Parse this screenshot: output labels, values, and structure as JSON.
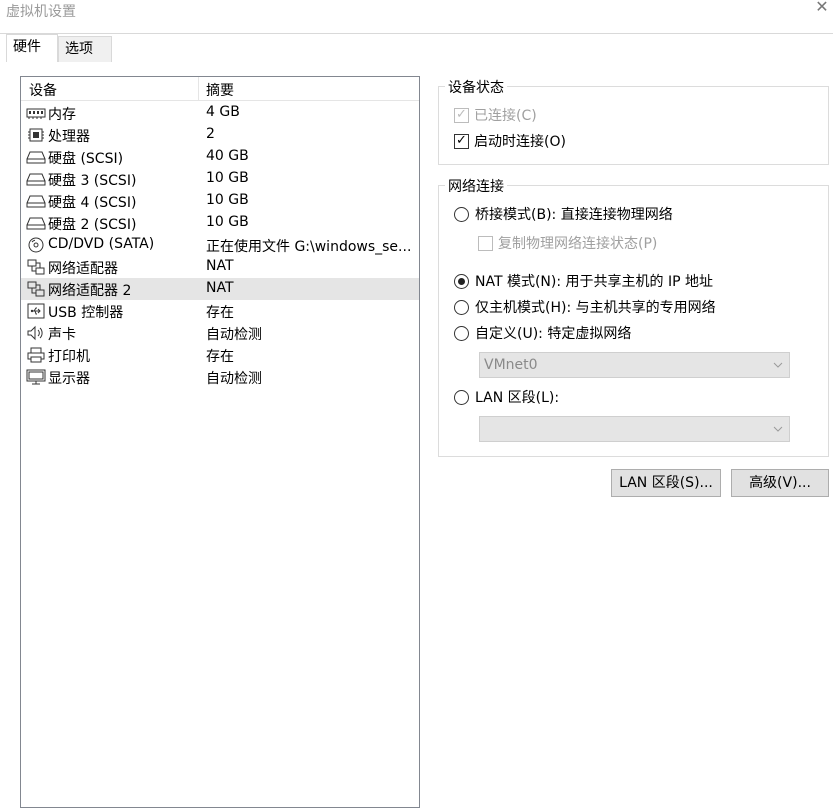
{
  "window": {
    "title": "虚拟机设置"
  },
  "tabs": [
    {
      "label": "硬件",
      "active": true
    },
    {
      "label": "选项",
      "active": false
    }
  ],
  "device_list": {
    "headers": {
      "device": "设备",
      "summary": "摘要"
    },
    "items": [
      {
        "icon": "memory-icon",
        "name": "内存",
        "summary": "4 GB"
      },
      {
        "icon": "cpu-icon",
        "name": "处理器",
        "summary": "2"
      },
      {
        "icon": "disk-icon",
        "name": "硬盘 (SCSI)",
        "summary": "40 GB"
      },
      {
        "icon": "disk-icon",
        "name": "硬盘 3 (SCSI)",
        "summary": "10 GB"
      },
      {
        "icon": "disk-icon",
        "name": "硬盘 4 (SCSI)",
        "summary": "10 GB"
      },
      {
        "icon": "disk-icon",
        "name": "硬盘 2 (SCSI)",
        "summary": "10 GB"
      },
      {
        "icon": "cd-icon",
        "name": "CD/DVD (SATA)",
        "summary": "正在使用文件 G:\\windows_se..."
      },
      {
        "icon": "network-icon",
        "name": "网络适配器",
        "summary": "NAT"
      },
      {
        "icon": "network-icon",
        "name": "网络适配器 2",
        "summary": "NAT",
        "selected": true
      },
      {
        "icon": "usb-icon",
        "name": "USB 控制器",
        "summary": "存在"
      },
      {
        "icon": "speaker-icon",
        "name": "声卡",
        "summary": "自动检测"
      },
      {
        "icon": "printer-icon",
        "name": "打印机",
        "summary": "存在"
      },
      {
        "icon": "monitor-icon",
        "name": "显示器",
        "summary": "自动检测"
      }
    ]
  },
  "device_status": {
    "label": "设备状态",
    "connected": {
      "label": "已连接(C)",
      "checked": true,
      "disabled": true
    },
    "connect_at_power_on": {
      "label": "启动时连接(O)",
      "checked": true,
      "disabled": false
    }
  },
  "network_connection": {
    "label": "网络连接",
    "bridged": {
      "label": "桥接模式(B): 直接连接物理网络",
      "selected": false
    },
    "replicate": {
      "label": "复制物理网络连接状态(P)",
      "checked": false,
      "disabled": true
    },
    "nat": {
      "label": "NAT 模式(N): 用于共享主机的 IP 地址",
      "selected": true
    },
    "host_only": {
      "label": "仅主机模式(H): 与主机共享的专用网络",
      "selected": false
    },
    "custom": {
      "label": "自定义(U): 特定虚拟网络",
      "selected": false
    },
    "custom_select_value": "VMnet0",
    "lan_segment": {
      "label": "LAN 区段(L):",
      "selected": false
    },
    "lan_select_value": ""
  },
  "buttons": {
    "lan_segments": "LAN 区段(S)...",
    "advanced": "高级(V)..."
  }
}
